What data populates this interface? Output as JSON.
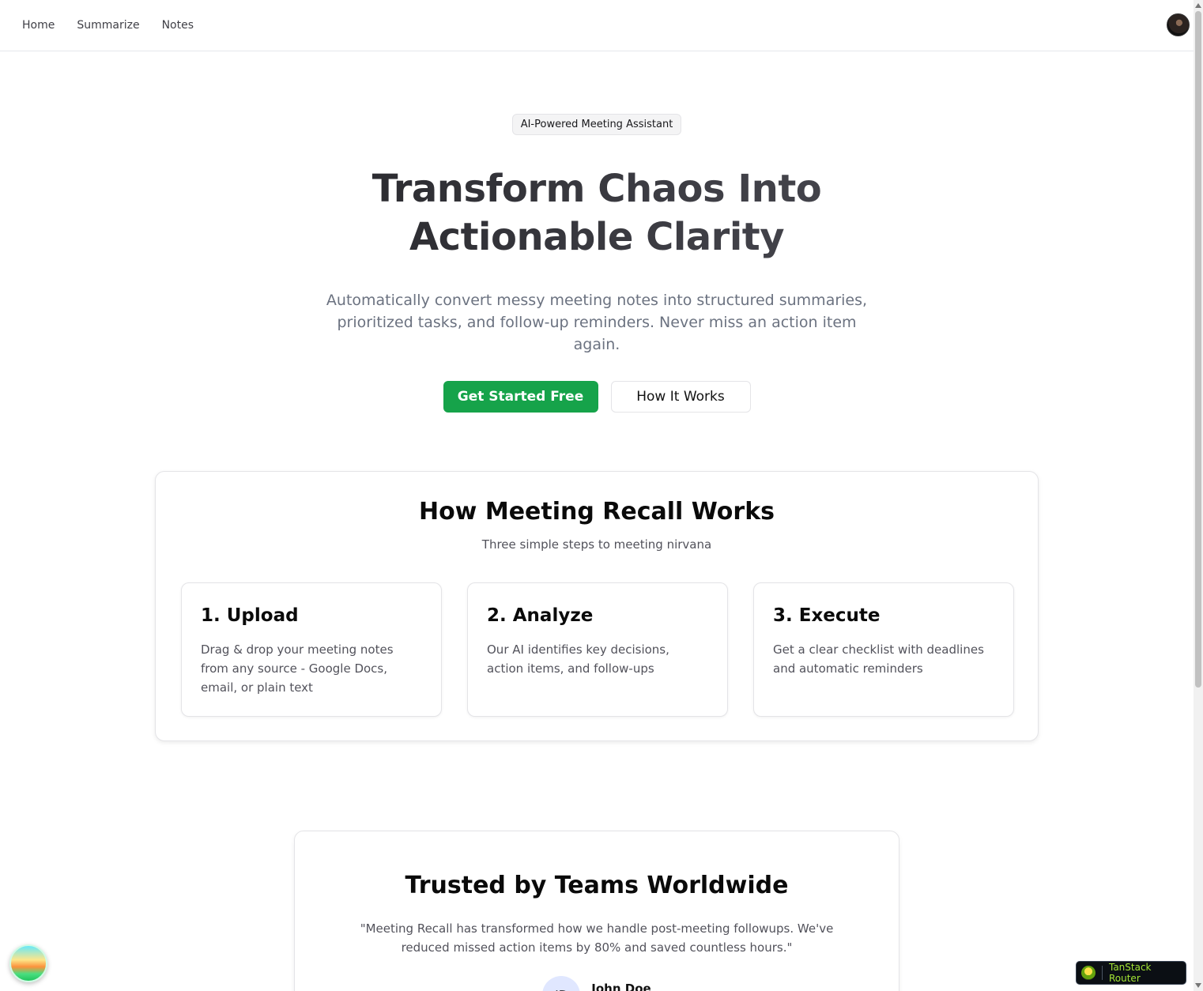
{
  "nav": {
    "items": [
      {
        "label": "Home"
      },
      {
        "label": "Summarize"
      },
      {
        "label": "Notes"
      }
    ]
  },
  "hero": {
    "badge": "AI-Powered Meeting Assistant",
    "title_line1": "Transform Chaos Into",
    "title_line2": "Actionable Clarity",
    "subtitle": "Automatically convert messy meeting notes into structured summaries, prioritized tasks, and follow-up reminders. Never miss an action item again.",
    "primary_cta": "Get Started Free",
    "secondary_cta": "How It Works"
  },
  "how": {
    "title": "How Meeting Recall Works",
    "subtitle": "Three simple steps to meeting nirvana",
    "steps": [
      {
        "title": "1. Upload",
        "description": "Drag & drop your meeting notes from any source - Google Docs, email, or plain text"
      },
      {
        "title": "2. Analyze",
        "description": "Our AI identifies key decisions, action items, and follow-ups"
      },
      {
        "title": "3. Execute",
        "description": "Get a clear checklist with deadlines and automatic reminders"
      }
    ]
  },
  "trust": {
    "title": "Trusted by Teams Worldwide",
    "quote": "\"Meeting Recall has transformed how we handle post-meeting followups. We've reduced missed action items by 80% and saved countless hours.\"",
    "author_initials": "JD",
    "author_name": "John Doe"
  },
  "widgets": {
    "router_label": "TanStack Router"
  },
  "colors": {
    "accent": "#16a34a",
    "border": "#e4e4e7",
    "muted_text": "#52525b"
  }
}
